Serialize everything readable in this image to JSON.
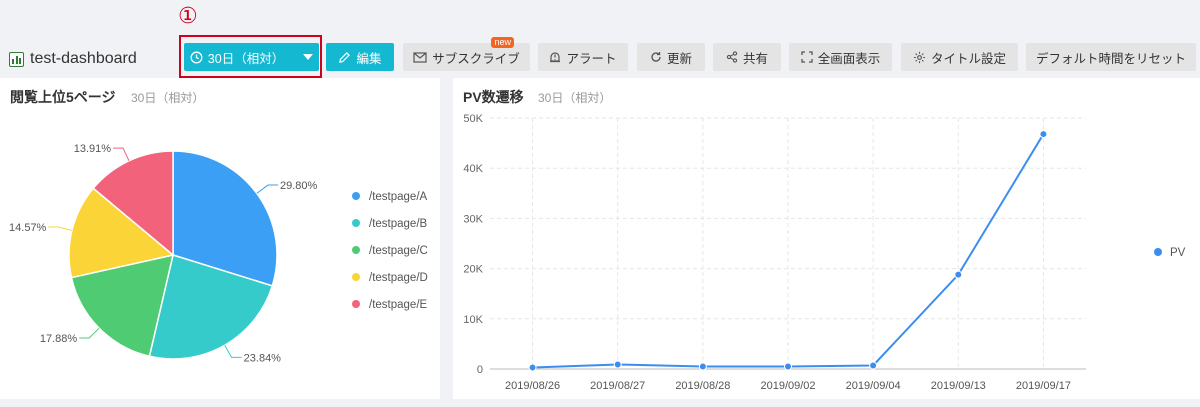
{
  "annotation": {
    "marker": "①"
  },
  "header": {
    "title": "test-dashboard",
    "icon": "dashboard-chart-icon"
  },
  "toolbar": {
    "time_range": "30日（相対）",
    "edit": "編集",
    "subscribe": "サブスクライブ",
    "subscribe_badge": "new",
    "alert": "アラート",
    "refresh": "更新",
    "share": "共有",
    "fullscreen": "全画面表示",
    "title_settings": "タイトル設定",
    "reset_time": "デフォルト時間をリセット"
  },
  "pie_panel": {
    "title": "閲覧上位5ページ",
    "range": "30日（相対）"
  },
  "line_panel": {
    "title": "PV数遷移",
    "range": "30日（相対）"
  },
  "colors": {
    "accent": "#15b8d1",
    "red_annotation": "#d0021b",
    "line": "#3b8ef0"
  },
  "chart_data": [
    {
      "type": "pie",
      "labels": [
        "/testpage/A",
        "/testpage/B",
        "/testpage/C",
        "/testpage/D",
        "/testpage/E"
      ],
      "values": [
        29.8,
        23.84,
        17.88,
        14.57,
        13.91
      ],
      "value_labels": [
        "29.80%",
        "23.84%",
        "17.88%",
        "14.57%",
        "13.91%"
      ],
      "colors": [
        "#3a9ff5",
        "#36cbcb",
        "#4ecb73",
        "#fbd437",
        "#f2637b"
      ],
      "legend": "right"
    },
    {
      "type": "line",
      "categories": [
        "2019/08/26",
        "2019/08/27",
        "2019/08/28",
        "2019/09/02",
        "2019/09/04",
        "2019/09/13",
        "2019/09/17"
      ],
      "series": [
        {
          "name": "PV",
          "values": [
            300,
            900,
            500,
            500,
            700,
            18800,
            46800
          ]
        }
      ],
      "ylim": [
        0,
        50000
      ],
      "yticks": [
        "0",
        "10K",
        "20K",
        "30K",
        "40K",
        "50K"
      ],
      "grid": true,
      "legend": "right"
    }
  ]
}
